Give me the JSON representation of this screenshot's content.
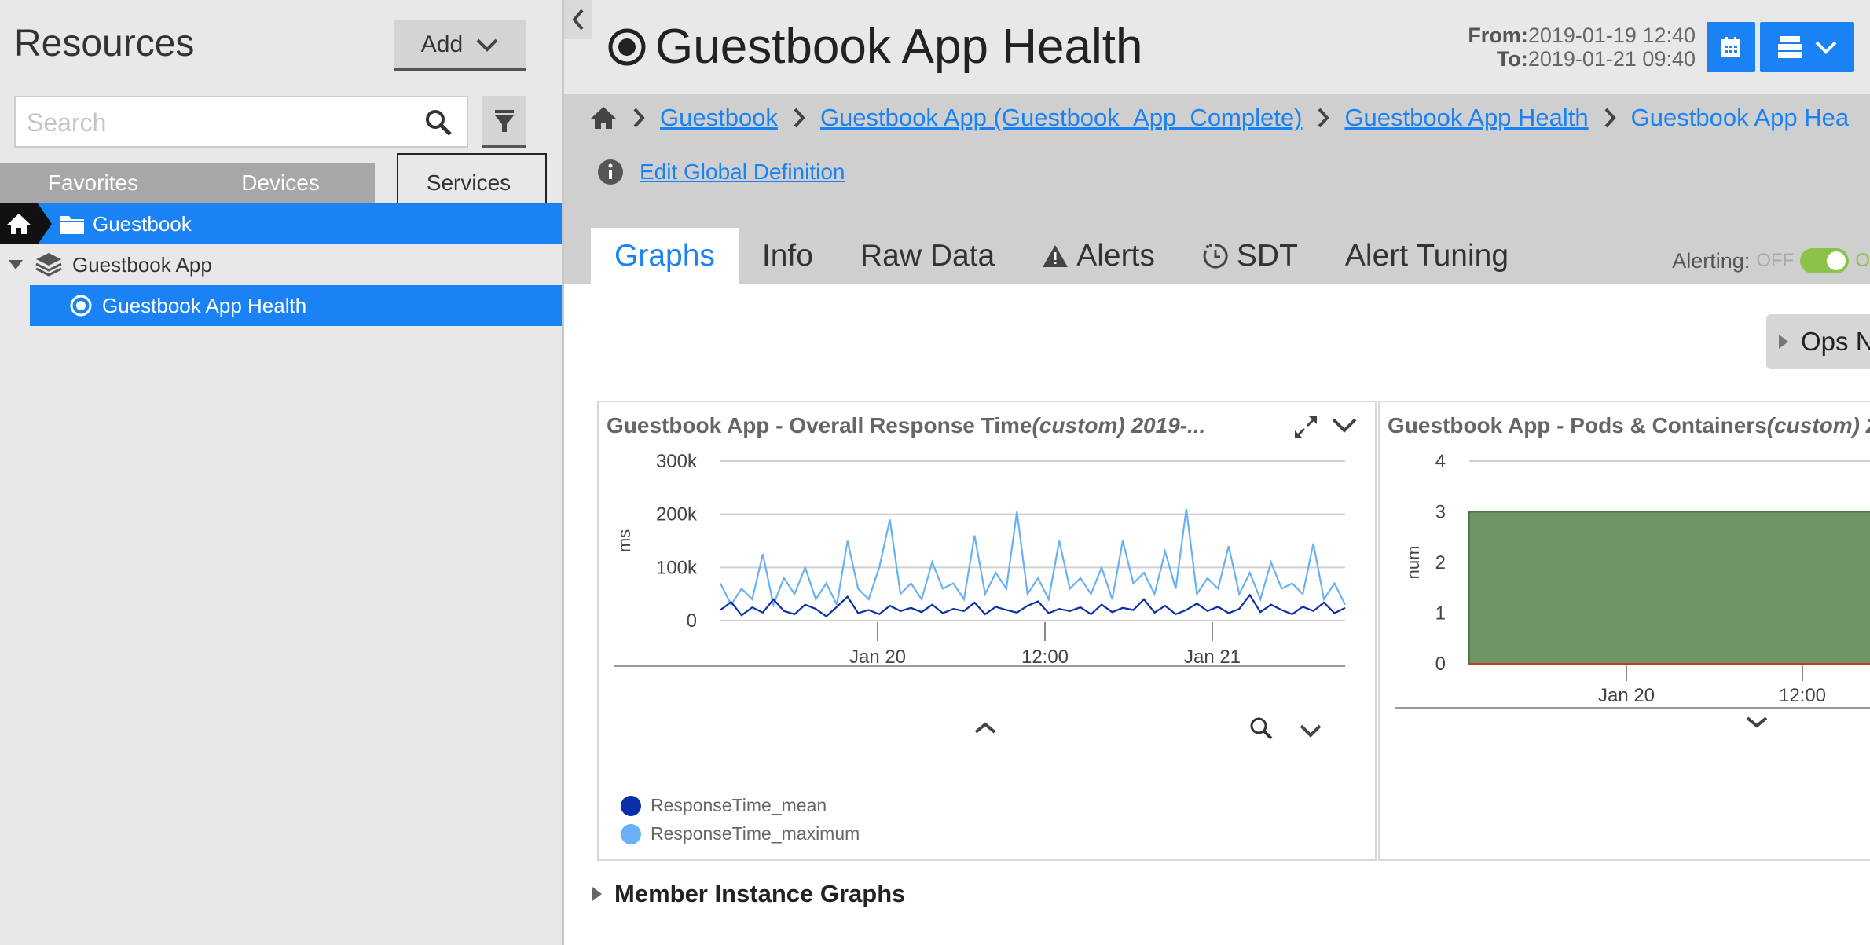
{
  "sidebar": {
    "title": "Resources",
    "add_label": "Add",
    "search_placeholder": "Search",
    "tabs": [
      "Favorites",
      "Devices",
      "Services"
    ],
    "tree": [
      {
        "label": "Guestbook"
      },
      {
        "label": "Guestbook App"
      },
      {
        "label": "Guestbook App Health"
      }
    ]
  },
  "header": {
    "title": "Guestbook App Health",
    "from_label": "From:",
    "from_value": "2019-01-19 12:40",
    "to_label": "To:",
    "to_value": "2019-01-21 09:40"
  },
  "breadcrumb": [
    "Guestbook",
    "Guestbook App (Guestbook_App_Complete)",
    "Guestbook App Health",
    "Guestbook App Hea"
  ],
  "edit_link": "Edit Global Definition",
  "tabs": [
    "Graphs",
    "Info",
    "Raw Data",
    "Alerts",
    "SDT",
    "Alert Tuning"
  ],
  "active_tab": "Graphs",
  "alerting": {
    "label": "Alerting:",
    "state": "OFF",
    "cut": "O"
  },
  "ops_notes_label": "Ops N",
  "member_graphs_label": "Member Instance Graphs",
  "colors": {
    "accent": "#1a82f5",
    "mean": "#0a2fa8",
    "maximum": "#6ab0f5",
    "pods": "#6f9564"
  },
  "chart_data": [
    {
      "type": "line",
      "title": "Guestbook App - Overall Response Time",
      "title_suffix": "(custom) 2019-...",
      "ylabel": "ms",
      "ylim": [
        0,
        300000
      ],
      "yticks": [
        "300k",
        "200k",
        "100k",
        "0"
      ],
      "xticks": [
        "Jan 20",
        "12:00",
        "Jan 21"
      ],
      "x_range": [
        "2019-01-19 12:40",
        "2019-01-21 09:40"
      ],
      "series": [
        {
          "name": "ResponseTime_mean",
          "values": [
            20000,
            35000,
            10000,
            25000,
            15000,
            40000,
            18000,
            12000,
            30000,
            22000,
            8000,
            26000,
            45000,
            14000,
            20000,
            12000,
            28000,
            18000,
            24000,
            16000,
            30000,
            14000,
            22000,
            18000,
            34000,
            12000,
            26000,
            20000,
            15000,
            28000,
            36000,
            14000,
            22000,
            18000,
            25000,
            12000,
            30000,
            16000,
            24000,
            20000,
            40000,
            15000,
            28000,
            12000,
            20000,
            32000,
            18000,
            26000,
            14000,
            22000,
            48000,
            16000,
            30000,
            20000,
            12000,
            26000,
            18000,
            34000,
            14000,
            24000
          ]
        },
        {
          "name": "ResponseTime_maximum",
          "values": [
            70000,
            30000,
            60000,
            40000,
            125000,
            30000,
            80000,
            50000,
            100000,
            40000,
            70000,
            30000,
            150000,
            60000,
            40000,
            100000,
            190000,
            50000,
            70000,
            40000,
            110000,
            60000,
            70000,
            40000,
            160000,
            50000,
            90000,
            60000,
            205000,
            50000,
            80000,
            40000,
            150000,
            60000,
            80000,
            50000,
            100000,
            40000,
            150000,
            70000,
            90000,
            50000,
            130000,
            60000,
            210000,
            50000,
            80000,
            60000,
            140000,
            50000,
            90000,
            40000,
            110000,
            60000,
            70000,
            50000,
            145000,
            40000,
            70000,
            30000
          ]
        }
      ]
    },
    {
      "type": "area",
      "title": "Guestbook App - Pods & Containers",
      "title_suffix": "(custom) 2",
      "ylabel": "num",
      "ylim": [
        0,
        4
      ],
      "yticks": [
        "4",
        "3",
        "2",
        "1",
        "0"
      ],
      "xticks": [
        "Jan 20",
        "12:00"
      ],
      "series": [
        {
          "values": [
            3,
            3,
            3,
            3,
            3,
            3
          ]
        }
      ]
    }
  ]
}
